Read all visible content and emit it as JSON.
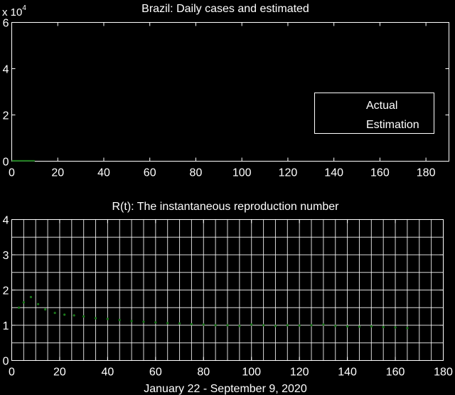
{
  "colors": {
    "background": "#000000",
    "foreground": "#ffffff",
    "series": "#1a7a1a"
  },
  "chart_data": [
    {
      "type": "line",
      "title": "Brazil: Daily cases and estimated",
      "xlabel": "",
      "ylabel": "",
      "xlim": [
        0,
        190
      ],
      "ylim": [
        0,
        6
      ],
      "y_exponent_label": "x 10",
      "y_exponent_power": "4",
      "xticks": [
        "0",
        "20",
        "40",
        "60",
        "80",
        "100",
        "120",
        "140",
        "160",
        "180"
      ],
      "yticks": [
        "0",
        "2",
        "4",
        "6"
      ],
      "grid": false,
      "legend": {
        "placement": "right",
        "entries": [
          "Actual",
          "Estimation"
        ]
      },
      "series": [
        {
          "name": "Actual",
          "x": [
            0,
            10
          ],
          "y": [
            0.02,
            0.02
          ]
        }
      ]
    },
    {
      "type": "scatter",
      "title": "R(t): The instantaneous reproduction number",
      "xlabel": "January 22 - September 9, 2020",
      "ylabel": "",
      "xlim": [
        0,
        180
      ],
      "ylim": [
        0,
        4
      ],
      "xticks": [
        "0",
        "20",
        "40",
        "60",
        "80",
        "100",
        "120",
        "140",
        "160",
        "180"
      ],
      "yticks": [
        "0",
        "1",
        "2",
        "3",
        "4"
      ],
      "grid": true,
      "series": [
        {
          "x": [
            3,
            5,
            8,
            11,
            14,
            18,
            22,
            26,
            30,
            35,
            40,
            45,
            50,
            55,
            60,
            65,
            70,
            75,
            80,
            85,
            90,
            95,
            100,
            105,
            110,
            115,
            120,
            125,
            130,
            135,
            140,
            145,
            150,
            155,
            160,
            165
          ],
          "y": [
            1.5,
            1.65,
            1.8,
            1.6,
            1.45,
            1.35,
            1.3,
            1.28,
            1.25,
            1.2,
            1.18,
            1.15,
            1.12,
            1.1,
            1.08,
            1.06,
            1.05,
            1.03,
            1.02,
            1.0,
            1.0,
            0.98,
            1.02,
            1.0,
            0.98,
            1.0,
            0.99,
            1.0,
            1.02,
            0.98,
            0.97,
            0.96,
            0.97,
            0.95,
            0.94,
            0.92
          ]
        }
      ]
    }
  ]
}
